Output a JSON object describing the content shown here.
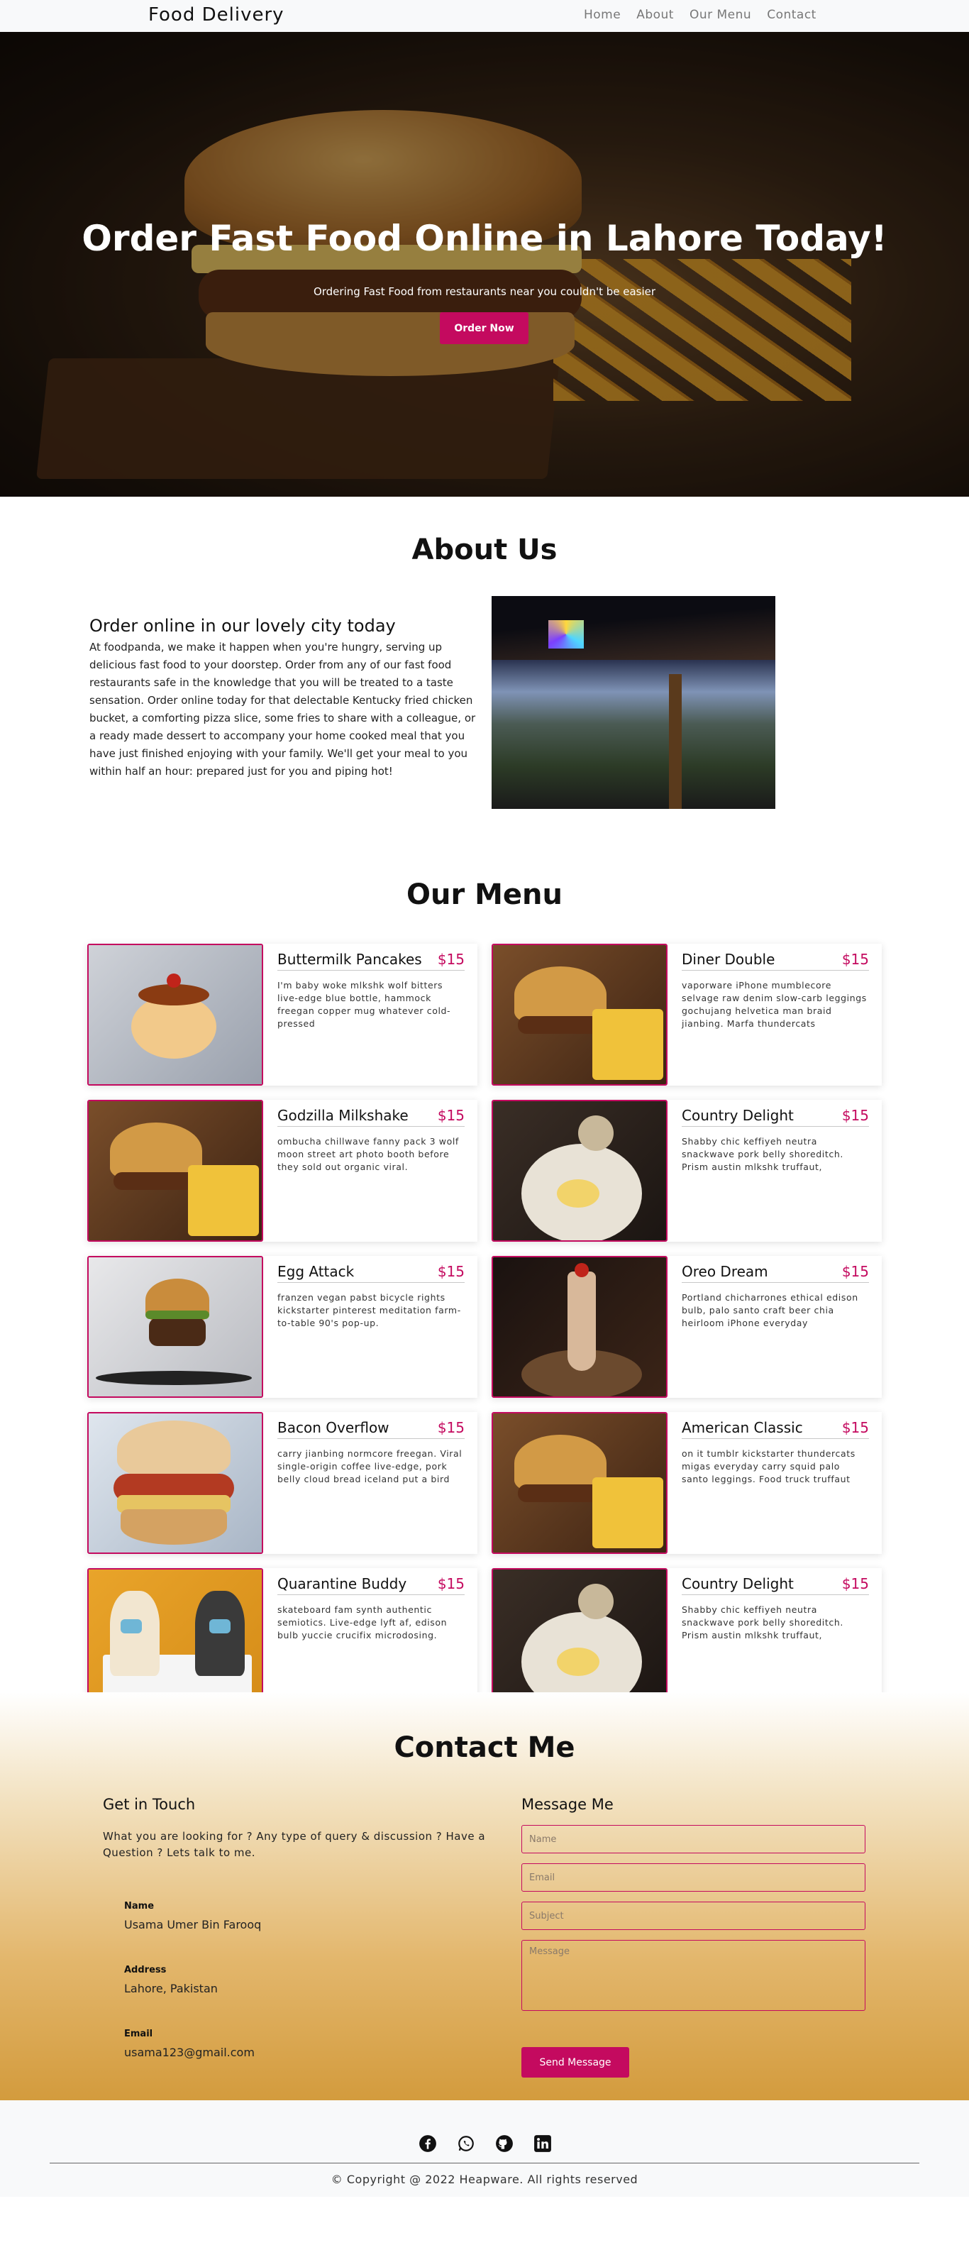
{
  "nav": {
    "brand": "Food Delivery",
    "links": [
      "Home",
      "About",
      "Our Menu",
      "Contact"
    ]
  },
  "hero": {
    "title": "Order Fast Food Online in Lahore Today!",
    "subtitle": "Ordering Fast Food from restaurants near you couldn't be easier",
    "button": "Order Now"
  },
  "about": {
    "title": "About Us",
    "heading": "Order online in our lovely city today",
    "text": "At foodpanda, we make it happen when you're hungry, serving up delicious fast food to your doorstep. Order from any of our fast food restaurants safe in the knowledge that you will be treated to a taste sensation. Order online today for that delectable Kentucky fried chicken bucket, a comforting pizza slice, some fries to share with a colleague, or a ready made dessert to accompany your home cooked meal that you have just finished enjoying with your family. We'll get your meal to you within half an hour: prepared just for you and piping hot!"
  },
  "menu": {
    "title": "Our Menu",
    "items": [
      {
        "name": "Buttermilk Pancakes",
        "price": "$15",
        "desc": "I'm baby woke mlkshk wolf bitters live-edge blue bottle, hammock freegan copper mug whatever cold-pressed",
        "img": "pancake"
      },
      {
        "name": "Diner Double",
        "price": "$15",
        "desc": "vaporware iPhone mumblecore selvage raw denim slow-carb leggings gochujang helvetica man braid jianbing. Marfa thundercats",
        "img": "burgerfries"
      },
      {
        "name": "Godzilla Milkshake",
        "price": "$15",
        "desc": "ombucha chillwave fanny pack 3 wolf moon street art photo booth before they sold out organic viral.",
        "img": "burgerfries"
      },
      {
        "name": "Country Delight",
        "price": "$15",
        "desc": "Shabby chic keffiyeh neutra snackwave pork belly shoreditch. Prism austin mlkshk truffaut,",
        "img": "plate"
      },
      {
        "name": "Egg Attack",
        "price": "$15",
        "desc": "franzen vegan pabst bicycle rights kickstarter pinterest meditation farm-to-table 90's pop-up.",
        "img": "bright"
      },
      {
        "name": "Oreo Dream",
        "price": "$15",
        "desc": "Portland chicharrones ethical edison bulb, palo santo craft beer chia heirloom iPhone everyday",
        "img": "dark"
      },
      {
        "name": "Bacon Overflow",
        "price": "$15",
        "desc": "carry jianbing normcore freegan. Viral single-origin coffee live-edge, pork belly cloud bread iceland put a bird",
        "img": "biscuit"
      },
      {
        "name": "American Classic",
        "price": "$15",
        "desc": "on it tumblr kickstarter thundercats migas everyday carry squid palo santo leggings. Food truck truffaut",
        "img": "burgerfries"
      },
      {
        "name": "Quarantine Buddy",
        "price": "$15",
        "desc": "skateboard fam synth authentic semiotics. Live-edge lyft af, edison bulb yuccie crucifix microdosing.",
        "img": "yellow"
      },
      {
        "name": "Country Delight",
        "price": "$15",
        "desc": "Shabby chic keffiyeh neutra snackwave pork belly shoreditch. Prism austin mlkshk truffaut,",
        "img": "plate"
      }
    ]
  },
  "contact": {
    "title": "Contact Me",
    "get_in_touch": "Get in Touch",
    "intro": "What you are looking for ? Any type of query & discussion ? Have a Question ? Lets talk to me.",
    "name_label": "Name",
    "name_value": "Usama Umer Bin Farooq",
    "address_label": "Address",
    "address_value": "Lahore, Pakistan",
    "email_label": "Email",
    "email_value": "usama123@gmail.com",
    "message_me": "Message Me",
    "form": {
      "name_placeholder": "Name",
      "email_placeholder": "Email",
      "subject_placeholder": "Subject",
      "message_placeholder": "Message",
      "send_button": "Send Message"
    }
  },
  "footer": {
    "icons": [
      "facebook-icon",
      "whatsapp-icon",
      "github-icon",
      "linkedin-icon"
    ],
    "copyright": "© Copyright @ 2022 Heapware. All rights reserved"
  },
  "colors": {
    "accent": "#c40a5f",
    "nav_bg": "#f8f9fa"
  }
}
